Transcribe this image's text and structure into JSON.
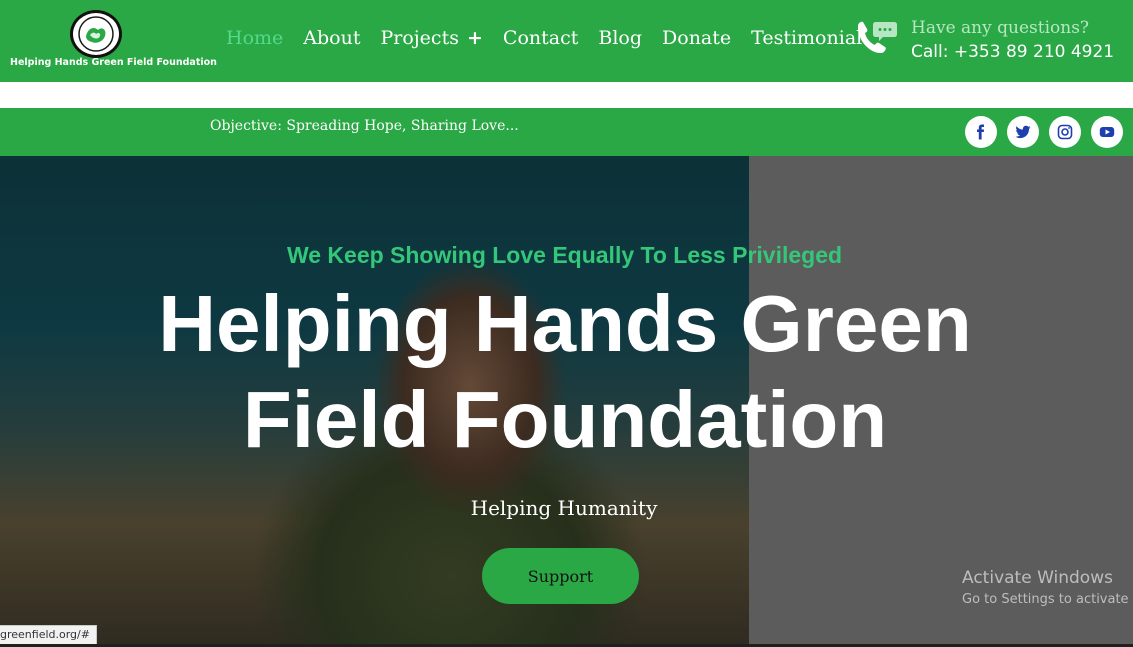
{
  "header": {
    "brand": "Helping Hands Green Field Foundation",
    "logo_text": "Helping Hands Green Field Foundation",
    "nav": [
      {
        "label": "Home",
        "active": true
      },
      {
        "label": "About"
      },
      {
        "label": "Projects",
        "suffix": "+"
      },
      {
        "label": "Contact"
      },
      {
        "label": "Blog"
      },
      {
        "label": "Donate"
      },
      {
        "label": "Testimonial"
      }
    ],
    "contact_question": "Have any questions?",
    "contact_call": "Call: +353 89 210 4921",
    "phone_icon": "phone-chat-icon"
  },
  "objective_bar": {
    "text": "Objective: Spreading Hope, Sharing Love...",
    "social": [
      "facebook-icon",
      "twitter-icon",
      "instagram-icon",
      "youtube-icon"
    ]
  },
  "hero": {
    "subtitle": "We Keep Showing Love Equally To Less Privileged",
    "title": "Helping Hands Green Field Foundation",
    "tagline": "Helping Humanity",
    "button": "Support"
  },
  "overlay": {
    "activate_title": "Activate Windows",
    "activate_sub": "Go to Settings to activate"
  },
  "status_bar": {
    "url": "greenfield.org/#"
  },
  "colors": {
    "brand_green": "#2aa845",
    "accent_green": "#34c779",
    "nav_active": "#54d98c",
    "social_icon": "#1d3fb0"
  }
}
